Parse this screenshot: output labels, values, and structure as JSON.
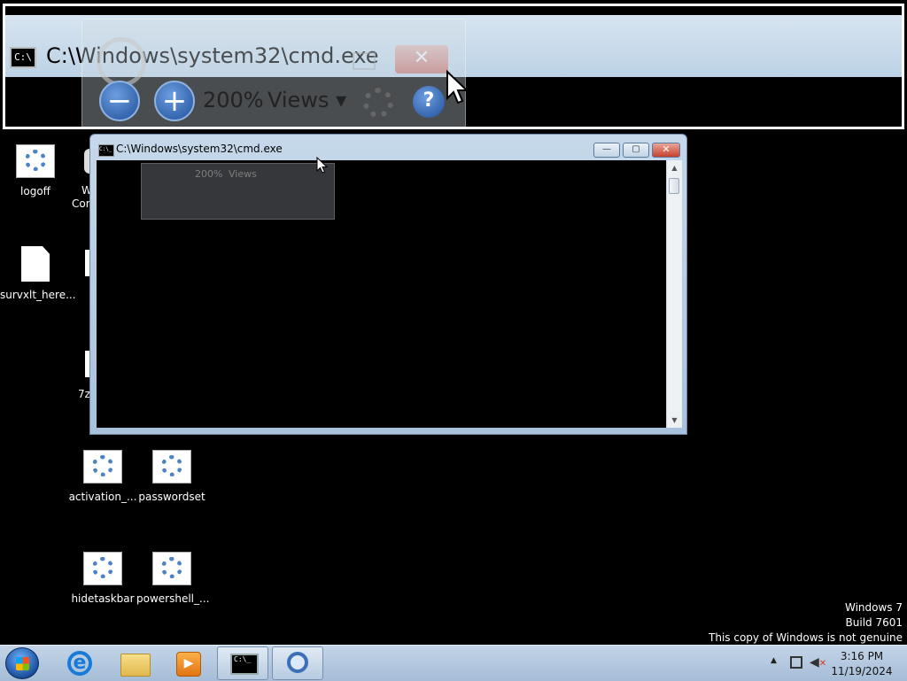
{
  "magnifier": {
    "title": "C:\\Windows\\system32\\cmd.exe",
    "zoom": "200%",
    "views_label": "Views",
    "close_glyph": "✕",
    "zoom_out_glyph": "−",
    "zoom_in_glyph": "+",
    "help_glyph": "?"
  },
  "cmd_window": {
    "title": "C:\\Windows\\system32\\cmd.exe",
    "minimize_glyph": "—",
    "maximize_glyph": "▢",
    "close_glyph": "✕",
    "icon_text": "C:\\_",
    "ghost_zoom": "200%",
    "ghost_views": "Views"
  },
  "desktop_icons": [
    {
      "label": "logoff"
    },
    {
      "label": "survxlt_here..."
    },
    {
      "label": "activation_..."
    },
    {
      "label": "passwordset"
    },
    {
      "label": "hidetaskbar"
    },
    {
      "label": "powershell_..."
    }
  ],
  "partial_labels": {
    "w": "W",
    "cor": "Cor",
    "seven_z": "7z"
  },
  "watermark": {
    "line1": "Windows 7",
    "line2": "Build 7601",
    "line3": "This copy of Windows is not genuine"
  },
  "taskbar": {
    "cmd_icon_text": "C:\\_",
    "tray_arrow": "▲",
    "time": "3:16 PM",
    "date": "11/19/2024"
  }
}
